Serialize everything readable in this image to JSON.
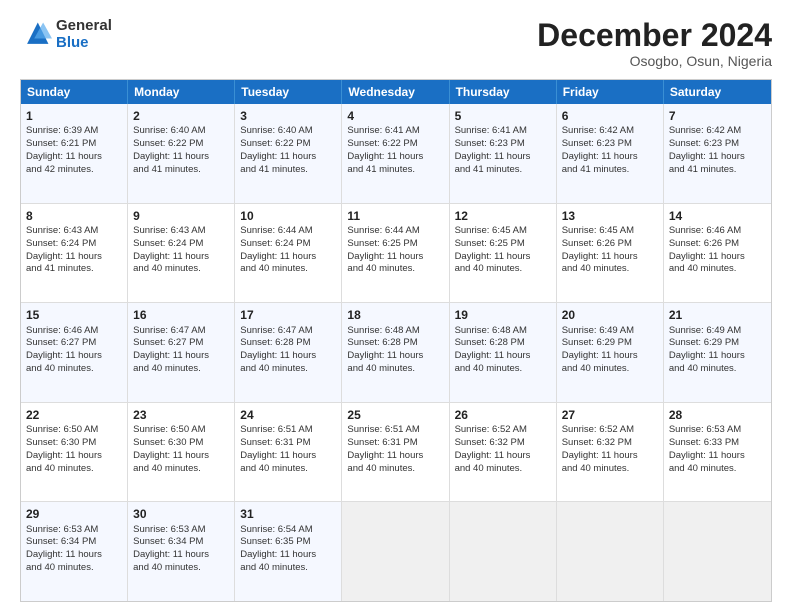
{
  "logo": {
    "general": "General",
    "blue": "Blue"
  },
  "header": {
    "month": "December 2024",
    "location": "Osogbo, Osun, Nigeria"
  },
  "weekdays": [
    "Sunday",
    "Monday",
    "Tuesday",
    "Wednesday",
    "Thursday",
    "Friday",
    "Saturday"
  ],
  "rows": [
    [
      {
        "day": "1",
        "lines": [
          "Sunrise: 6:39 AM",
          "Sunset: 6:21 PM",
          "Daylight: 11 hours",
          "and 42 minutes."
        ]
      },
      {
        "day": "2",
        "lines": [
          "Sunrise: 6:40 AM",
          "Sunset: 6:22 PM",
          "Daylight: 11 hours",
          "and 41 minutes."
        ]
      },
      {
        "day": "3",
        "lines": [
          "Sunrise: 6:40 AM",
          "Sunset: 6:22 PM",
          "Daylight: 11 hours",
          "and 41 minutes."
        ]
      },
      {
        "day": "4",
        "lines": [
          "Sunrise: 6:41 AM",
          "Sunset: 6:22 PM",
          "Daylight: 11 hours",
          "and 41 minutes."
        ]
      },
      {
        "day": "5",
        "lines": [
          "Sunrise: 6:41 AM",
          "Sunset: 6:23 PM",
          "Daylight: 11 hours",
          "and 41 minutes."
        ]
      },
      {
        "day": "6",
        "lines": [
          "Sunrise: 6:42 AM",
          "Sunset: 6:23 PM",
          "Daylight: 11 hours",
          "and 41 minutes."
        ]
      },
      {
        "day": "7",
        "lines": [
          "Sunrise: 6:42 AM",
          "Sunset: 6:23 PM",
          "Daylight: 11 hours",
          "and 41 minutes."
        ]
      }
    ],
    [
      {
        "day": "8",
        "lines": [
          "Sunrise: 6:43 AM",
          "Sunset: 6:24 PM",
          "Daylight: 11 hours",
          "and 41 minutes."
        ]
      },
      {
        "day": "9",
        "lines": [
          "Sunrise: 6:43 AM",
          "Sunset: 6:24 PM",
          "Daylight: 11 hours",
          "and 40 minutes."
        ]
      },
      {
        "day": "10",
        "lines": [
          "Sunrise: 6:44 AM",
          "Sunset: 6:24 PM",
          "Daylight: 11 hours",
          "and 40 minutes."
        ]
      },
      {
        "day": "11",
        "lines": [
          "Sunrise: 6:44 AM",
          "Sunset: 6:25 PM",
          "Daylight: 11 hours",
          "and 40 minutes."
        ]
      },
      {
        "day": "12",
        "lines": [
          "Sunrise: 6:45 AM",
          "Sunset: 6:25 PM",
          "Daylight: 11 hours",
          "and 40 minutes."
        ]
      },
      {
        "day": "13",
        "lines": [
          "Sunrise: 6:45 AM",
          "Sunset: 6:26 PM",
          "Daylight: 11 hours",
          "and 40 minutes."
        ]
      },
      {
        "day": "14",
        "lines": [
          "Sunrise: 6:46 AM",
          "Sunset: 6:26 PM",
          "Daylight: 11 hours",
          "and 40 minutes."
        ]
      }
    ],
    [
      {
        "day": "15",
        "lines": [
          "Sunrise: 6:46 AM",
          "Sunset: 6:27 PM",
          "Daylight: 11 hours",
          "and 40 minutes."
        ]
      },
      {
        "day": "16",
        "lines": [
          "Sunrise: 6:47 AM",
          "Sunset: 6:27 PM",
          "Daylight: 11 hours",
          "and 40 minutes."
        ]
      },
      {
        "day": "17",
        "lines": [
          "Sunrise: 6:47 AM",
          "Sunset: 6:28 PM",
          "Daylight: 11 hours",
          "and 40 minutes."
        ]
      },
      {
        "day": "18",
        "lines": [
          "Sunrise: 6:48 AM",
          "Sunset: 6:28 PM",
          "Daylight: 11 hours",
          "and 40 minutes."
        ]
      },
      {
        "day": "19",
        "lines": [
          "Sunrise: 6:48 AM",
          "Sunset: 6:28 PM",
          "Daylight: 11 hours",
          "and 40 minutes."
        ]
      },
      {
        "day": "20",
        "lines": [
          "Sunrise: 6:49 AM",
          "Sunset: 6:29 PM",
          "Daylight: 11 hours",
          "and 40 minutes."
        ]
      },
      {
        "day": "21",
        "lines": [
          "Sunrise: 6:49 AM",
          "Sunset: 6:29 PM",
          "Daylight: 11 hours",
          "and 40 minutes."
        ]
      }
    ],
    [
      {
        "day": "22",
        "lines": [
          "Sunrise: 6:50 AM",
          "Sunset: 6:30 PM",
          "Daylight: 11 hours",
          "and 40 minutes."
        ]
      },
      {
        "day": "23",
        "lines": [
          "Sunrise: 6:50 AM",
          "Sunset: 6:30 PM",
          "Daylight: 11 hours",
          "and 40 minutes."
        ]
      },
      {
        "day": "24",
        "lines": [
          "Sunrise: 6:51 AM",
          "Sunset: 6:31 PM",
          "Daylight: 11 hours",
          "and 40 minutes."
        ]
      },
      {
        "day": "25",
        "lines": [
          "Sunrise: 6:51 AM",
          "Sunset: 6:31 PM",
          "Daylight: 11 hours",
          "and 40 minutes."
        ]
      },
      {
        "day": "26",
        "lines": [
          "Sunrise: 6:52 AM",
          "Sunset: 6:32 PM",
          "Daylight: 11 hours",
          "and 40 minutes."
        ]
      },
      {
        "day": "27",
        "lines": [
          "Sunrise: 6:52 AM",
          "Sunset: 6:32 PM",
          "Daylight: 11 hours",
          "and 40 minutes."
        ]
      },
      {
        "day": "28",
        "lines": [
          "Sunrise: 6:53 AM",
          "Sunset: 6:33 PM",
          "Daylight: 11 hours",
          "and 40 minutes."
        ]
      }
    ],
    [
      {
        "day": "29",
        "lines": [
          "Sunrise: 6:53 AM",
          "Sunset: 6:34 PM",
          "Daylight: 11 hours",
          "and 40 minutes."
        ]
      },
      {
        "day": "30",
        "lines": [
          "Sunrise: 6:53 AM",
          "Sunset: 6:34 PM",
          "Daylight: 11 hours",
          "and 40 minutes."
        ]
      },
      {
        "day": "31",
        "lines": [
          "Sunrise: 6:54 AM",
          "Sunset: 6:35 PM",
          "Daylight: 11 hours",
          "and 40 minutes."
        ]
      },
      {
        "day": "",
        "lines": []
      },
      {
        "day": "",
        "lines": []
      },
      {
        "day": "",
        "lines": []
      },
      {
        "day": "",
        "lines": []
      }
    ]
  ]
}
